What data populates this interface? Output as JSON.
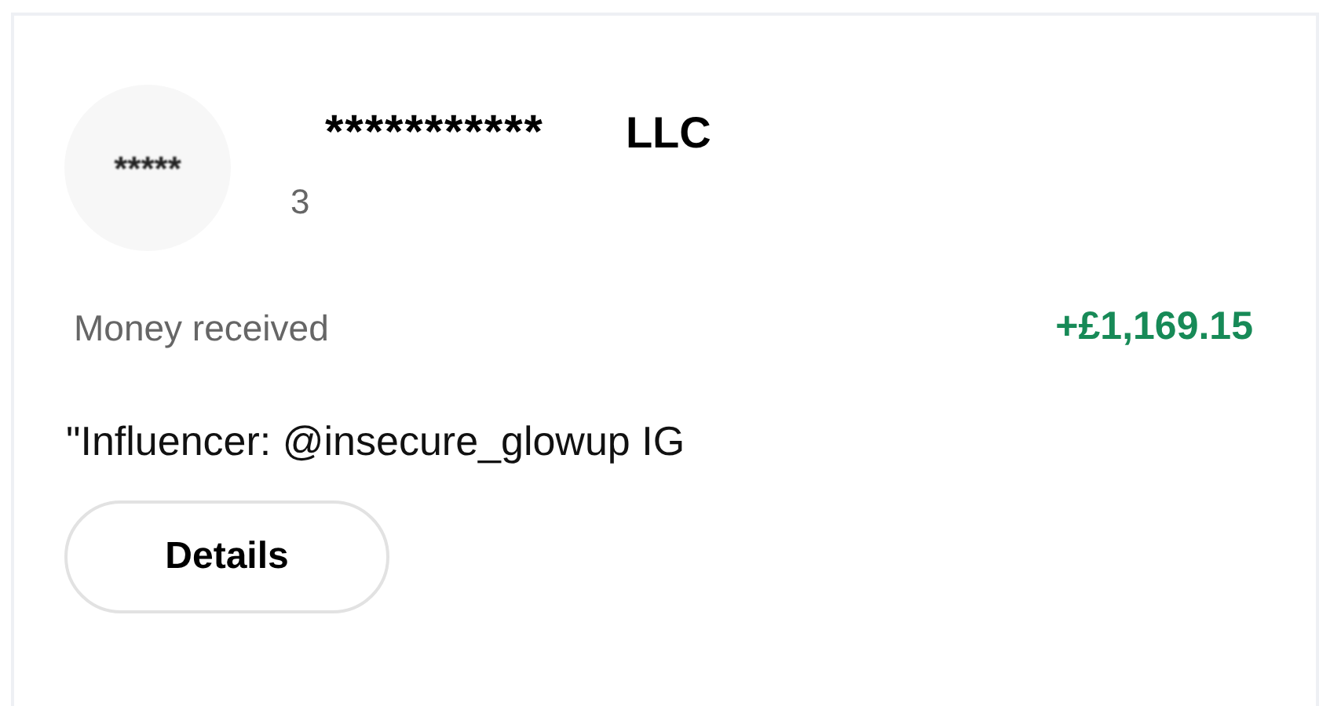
{
  "avatar": {
    "initials": "*****"
  },
  "merchant": {
    "name": "***********",
    "suffix": "LLC",
    "subtitle": "3"
  },
  "transaction": {
    "label": "Money received",
    "amount": "+£1,169.15",
    "note": "\"Influencer: @insecure_glowup IG"
  },
  "buttons": [
    "Details"
  ]
}
